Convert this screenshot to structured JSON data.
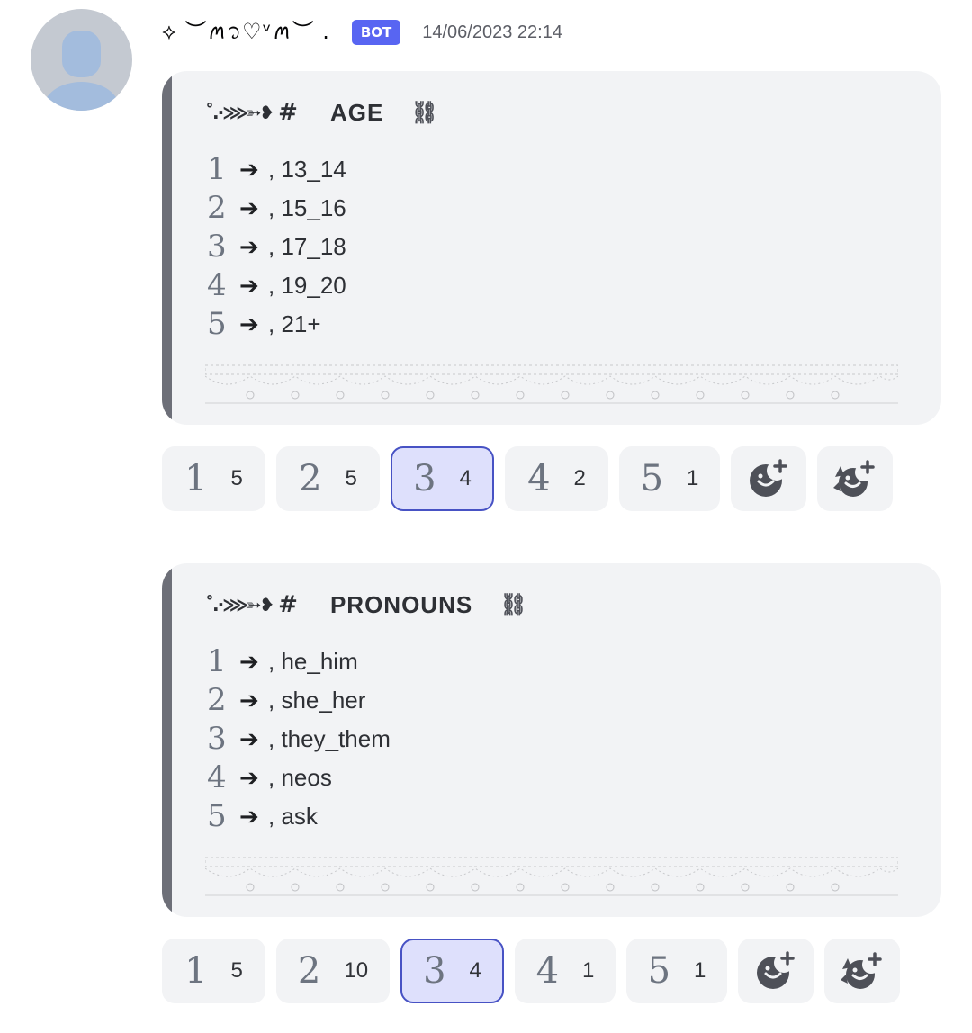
{
  "message": {
    "username": "⟡ ︶ꪔ᭡♡ᵛꪔ︶ .",
    "bot_badge": "BOT",
    "timestamp": "14/06/2023 22:14"
  },
  "embeds": [
    {
      "title_deco": "˚.·⋙➳❥",
      "title_hash": "#",
      "title": "AGE",
      "title_link": "⛓",
      "options": [
        {
          "num": "1",
          "arrow": "➔",
          "label": ", 13_14"
        },
        {
          "num": "2",
          "arrow": "➔",
          "label": ", 15_16"
        },
        {
          "num": "3",
          "arrow": "➔",
          "label": ", 17_18"
        },
        {
          "num": "4",
          "arrow": "➔",
          "label": ", 19_20"
        },
        {
          "num": "5",
          "arrow": "➔",
          "label": ", 21+"
        }
      ],
      "reactions": [
        {
          "num": "1",
          "count": "5",
          "selected": false
        },
        {
          "num": "2",
          "count": "5",
          "selected": false
        },
        {
          "num": "3",
          "count": "4",
          "selected": true
        },
        {
          "num": "4",
          "count": "2",
          "selected": false
        },
        {
          "num": "5",
          "count": "1",
          "selected": false
        }
      ],
      "actions": [
        "add-reaction-icon",
        "add-super-reaction-icon"
      ]
    },
    {
      "title_deco": "˚.·⋙➳❥",
      "title_hash": "#",
      "title": "PRONOUNS",
      "title_link": "⛓",
      "options": [
        {
          "num": "1",
          "arrow": "➔",
          "label": ", he_him"
        },
        {
          "num": "2",
          "arrow": "➔",
          "label": ", she_her"
        },
        {
          "num": "3",
          "arrow": "➔",
          "label": ", they_them"
        },
        {
          "num": "4",
          "arrow": "➔",
          "label": ", neos"
        },
        {
          "num": "5",
          "arrow": "➔",
          "label": ", ask"
        }
      ],
      "reactions": [
        {
          "num": "1",
          "count": "5",
          "selected": false
        },
        {
          "num": "2",
          "count": "10",
          "selected": false
        },
        {
          "num": "3",
          "count": "4",
          "selected": true
        },
        {
          "num": "4",
          "count": "1",
          "selected": false
        },
        {
          "num": "5",
          "count": "1",
          "selected": false
        }
      ],
      "actions": [
        "add-reaction-icon",
        "add-super-reaction-icon"
      ]
    }
  ],
  "colors": {
    "accent": "#5865f2",
    "selected_bg": "#dee0fc",
    "selected_border": "#4752c4",
    "embed_bg": "#f2f3f5",
    "embed_bar": "#6d6f78"
  }
}
